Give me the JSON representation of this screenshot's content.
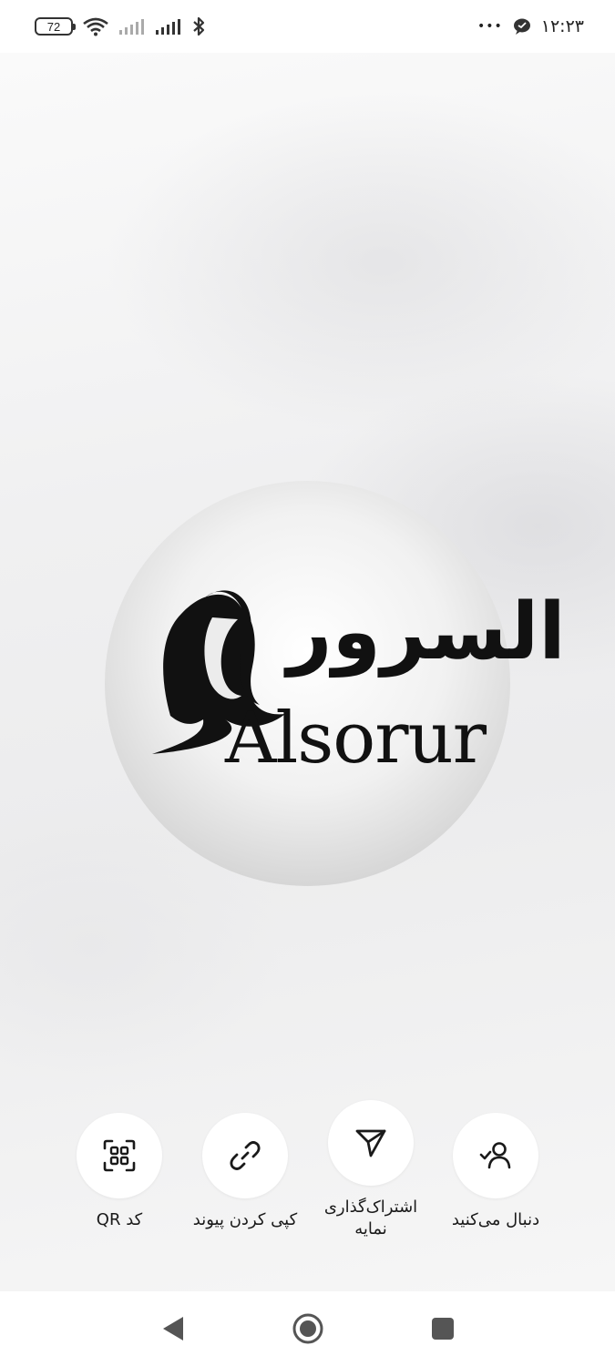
{
  "status_bar": {
    "battery": "72",
    "time": "۱۲:۲۳",
    "more": "•••",
    "icons": [
      "wifi-icon",
      "signal-icon",
      "signal-icon",
      "bluetooth-icon",
      "chat-bubble-icon"
    ]
  },
  "story": {
    "logo_arabic": "السرور",
    "logo_latin": "Alsorur"
  },
  "actions": {
    "qr": {
      "label": "کد QR",
      "icon": "qr-code-icon"
    },
    "copy_link": {
      "label": "کپی کردن پیوند",
      "icon": "link-icon"
    },
    "share": {
      "label": "اشتراک‌گذاری\nنمایه",
      "icon": "send-icon"
    },
    "following": {
      "label": "دنبال می‌کنید",
      "icon": "user-check-icon"
    }
  },
  "nav": {
    "icons": [
      "back-icon",
      "home-icon",
      "recents-icon"
    ]
  },
  "colors": {
    "background": "#ffffff",
    "icon": "#1a1a1a",
    "circle": "#ffffff"
  }
}
